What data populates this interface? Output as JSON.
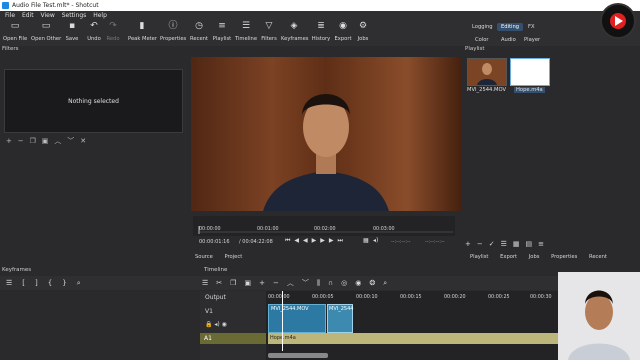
{
  "window": {
    "title": "Audio File Test.mlt* - Shotcut"
  },
  "menu": [
    "File",
    "Edit",
    "View",
    "Settings",
    "Help"
  ],
  "toolbar": {
    "items": [
      {
        "label": "Open File",
        "icon": "folder-icon"
      },
      {
        "label": "Open Other",
        "icon": "folder-plus-icon"
      },
      {
        "label": "Save",
        "icon": "save-icon"
      },
      {
        "label": "Undo",
        "icon": "undo-icon"
      },
      {
        "label": "Redo",
        "icon": "redo-icon"
      },
      {
        "label": "Peak Meter",
        "icon": "meter-icon"
      },
      {
        "label": "Properties",
        "icon": "info-icon"
      },
      {
        "label": "Recent",
        "icon": "clock-icon"
      },
      {
        "label": "Playlist",
        "icon": "list-icon"
      },
      {
        "label": "Timeline",
        "icon": "timeline-icon"
      },
      {
        "label": "Filters",
        "icon": "funnel-icon"
      },
      {
        "label": "Keyframes",
        "icon": "keyframes-icon"
      },
      {
        "label": "History",
        "icon": "history-icon"
      },
      {
        "label": "Export",
        "icon": "export-icon"
      },
      {
        "label": "Jobs",
        "icon": "jobs-icon"
      }
    ],
    "workspaces": {
      "row1": [
        "Logging",
        "Editing",
        "FX"
      ],
      "row2": [
        "Color",
        "Audio",
        "Player"
      ],
      "active": "Editing"
    }
  },
  "filters": {
    "title": "Filters",
    "empty_text": "Nothing selected"
  },
  "player": {
    "source_tab": "Source",
    "project_tab": "Project",
    "position": "00:00:01:16",
    "duration": "/ 00:04:22:08",
    "ruler": [
      "00:00:00",
      "00:01:00",
      "00:02:00",
      "00:03:00"
    ],
    "in_point": "--:--:--:--",
    "out_point": "--:--:--:--"
  },
  "playlist": {
    "title": "Playlist",
    "items": [
      {
        "label": "MVI_2544.MOV"
      },
      {
        "label": "Hope.m4a"
      }
    ],
    "tabs": [
      "Playlist",
      "Export",
      "Jobs",
      "Properties",
      "Recent"
    ]
  },
  "keyframes": {
    "title": "Keyframes"
  },
  "timeline": {
    "title": "Timeline",
    "tracks": [
      "Output",
      "V1",
      "A1"
    ],
    "ruler": [
      "00:00:00",
      "00:00:05",
      "00:00:10",
      "00:00:15",
      "00:00:20",
      "00:00:25",
      "00:00:30"
    ],
    "clips": {
      "video1": "MVI_2544.MOV",
      "video2": "MVI_2544",
      "audio": "Hope.m4a"
    }
  },
  "colors": {
    "clip": "#2c7aa4",
    "audio": "#bdb67a",
    "accent": "#35506e"
  }
}
